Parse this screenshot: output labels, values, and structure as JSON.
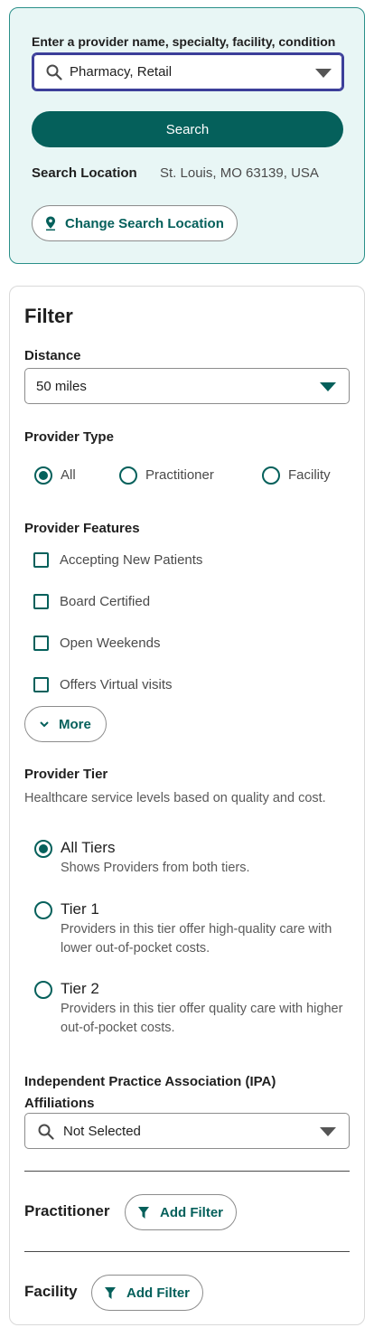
{
  "search": {
    "label": "Enter a provider name, specialty, facility, condition",
    "value": "Pharmacy, Retail",
    "button_label": "Search",
    "location_label": "Search Location",
    "location_value": "St. Louis, MO 63139, USA",
    "change_location_label": "Change Search Location"
  },
  "filter": {
    "title": "Filter",
    "distance": {
      "label": "Distance",
      "value": "50 miles"
    },
    "provider_type": {
      "label": "Provider Type",
      "options": [
        "All",
        "Practitioner",
        "Facility"
      ],
      "selected": "All"
    },
    "provider_features": {
      "label": "Provider Features",
      "options": [
        "Accepting New Patients",
        "Board Certified",
        "Open Weekends",
        "Offers Virtual visits"
      ],
      "more_label": "More"
    },
    "provider_tier": {
      "label": "Provider Tier",
      "description": "Healthcare service levels based on quality and cost.",
      "options": [
        {
          "name": "All Tiers",
          "description": "Shows Providers from both tiers.",
          "selected": true
        },
        {
          "name": "Tier 1",
          "description": "Providers in this tier offer high-quality care with lower out-of-pocket costs.",
          "selected": false
        },
        {
          "name": "Tier 2",
          "description": "Providers in this tier offer quality care with higher out-of-pocket costs.",
          "selected": false
        }
      ]
    },
    "ipa": {
      "label": "Independent Practice Association (IPA) Affiliations",
      "value": "Not Selected"
    },
    "practitioner": {
      "label": "Practitioner",
      "button_label": "Add Filter"
    },
    "facility": {
      "label": "Facility",
      "button_label": "Add Filter"
    }
  },
  "colors": {
    "accent": "#05605b",
    "search_card_bg": "#e8f6f5",
    "focus_border": "#3c3f9a"
  },
  "icons": {
    "search": "search-icon",
    "dropdown": "caret-down-icon",
    "location": "location-pin-icon",
    "more": "chevron-down-icon",
    "filter": "funnel-icon"
  }
}
